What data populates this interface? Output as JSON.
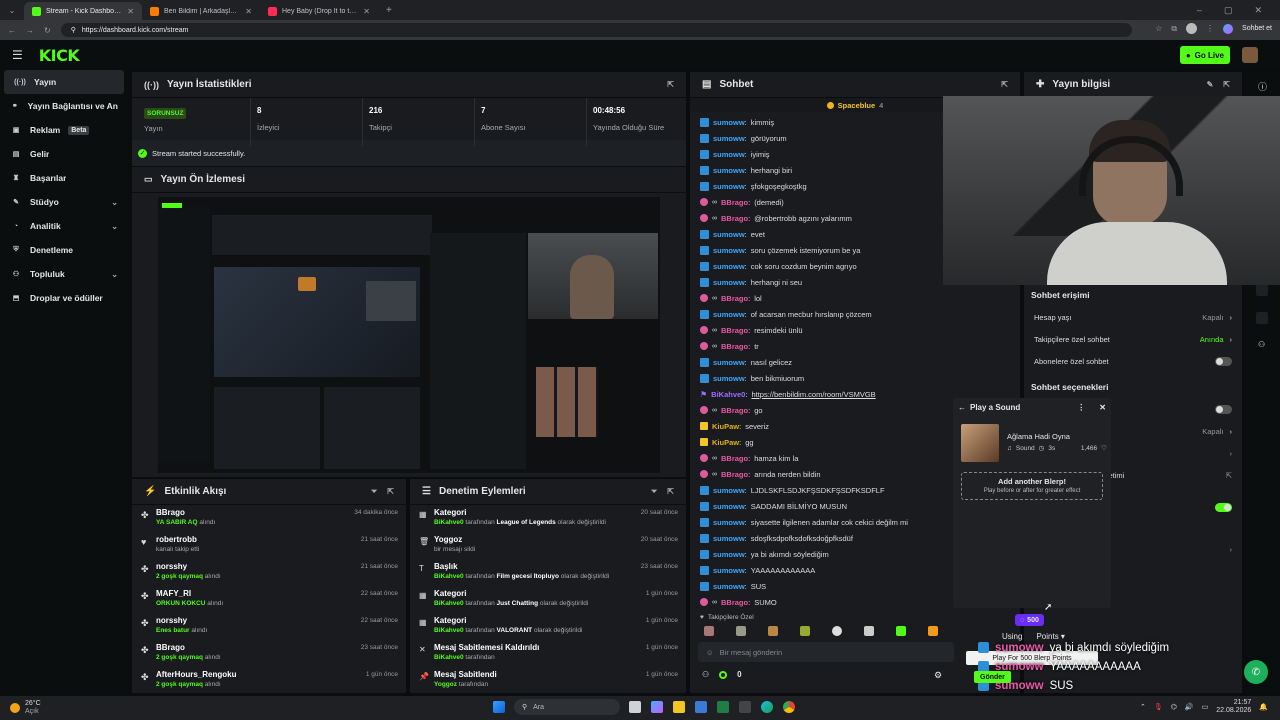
{
  "browser": {
    "tabs": [
      {
        "title": "Stream - Kick Dashboard",
        "color": "#53fc18"
      },
      {
        "title": "Ben Bildim | Arkadaşlarınla Online",
        "color": "#ff7a00"
      },
      {
        "title": "Hey Baby (Drop It to the Floo...",
        "color": "#ff2b55"
      }
    ],
    "url": "https://dashboard.kick.com/stream",
    "profile_label": "Sohbet et"
  },
  "app": {
    "logo": "KICK",
    "go_live": "Go Live"
  },
  "sidebar": [
    {
      "label": "Yayın",
      "icon": "broadcast-icon",
      "glyph": "((·))",
      "active": true,
      "chev": false,
      "beta": false
    },
    {
      "label": "Yayın Bağlantısı ve Anahtarı",
      "icon": "link-icon",
      "glyph": "⚭",
      "active": false,
      "chev": false,
      "beta": false
    },
    {
      "label": "Reklam",
      "icon": "ad-icon",
      "glyph": "▣",
      "active": false,
      "chev": false,
      "beta": true
    },
    {
      "label": "Gelir",
      "icon": "revenue-icon",
      "glyph": "▤",
      "active": false,
      "chev": false,
      "beta": false
    },
    {
      "label": "Başarılar",
      "icon": "trophy-icon",
      "glyph": "♜",
      "active": false,
      "chev": false,
      "beta": false
    },
    {
      "label": "Stüdyo",
      "icon": "studio-icon",
      "glyph": "✎",
      "active": false,
      "chev": true,
      "beta": false
    },
    {
      "label": "Analitik",
      "icon": "analytics-icon",
      "glyph": "◔",
      "active": false,
      "chev": true,
      "beta": false
    },
    {
      "label": "Denetleme",
      "icon": "moderation-icon",
      "glyph": "⛨",
      "active": false,
      "chev": false,
      "beta": false
    },
    {
      "label": "Topluluk",
      "icon": "community-icon",
      "glyph": "⚇",
      "active": false,
      "chev": true,
      "beta": false
    },
    {
      "label": "Droplar ve ödüller",
      "icon": "drops-icon",
      "glyph": "⬒",
      "active": false,
      "chev": false,
      "beta": false
    }
  ],
  "beta_label": "Beta",
  "stats": {
    "title": "Yayın İstatistikleri",
    "status_badge": "SORUNSUZ",
    "status_label": "Yayın",
    "viewers": "8",
    "viewers_label": "İzleyici",
    "followers": "216",
    "followers_label": "Takipçi",
    "subs": "7",
    "subs_label": "Abone Sayısı",
    "uptime": "00:48:56",
    "uptime_label": "Yayında Olduğu Süre",
    "message": "Stream started successfully."
  },
  "preview": {
    "title": "Yayın Ön İzlemesi"
  },
  "activity": {
    "title": "Etkinlik Akışı",
    "rows": [
      {
        "user": "BBrago",
        "detail_g": "YA SABIR AQ",
        "detail": " alındı",
        "time": "34 dakika önce",
        "icon": "reward-icon",
        "glyph": "✤"
      },
      {
        "user": "robertrobb",
        "detail_g": "",
        "detail": "kanalı takip etti",
        "time": "21 saat önce",
        "icon": "heart-icon",
        "glyph": "♥"
      },
      {
        "user": "norsshy",
        "detail_g": "2 goşk qaymaq",
        "detail": " alındı",
        "time": "21 saat önce",
        "icon": "reward-icon",
        "glyph": "✤"
      },
      {
        "user": "MAFY_RI",
        "detail_g": "ORKUN KOKCU",
        "detail": " alındı",
        "time": "22 saat önce",
        "icon": "reward-icon",
        "glyph": "✤"
      },
      {
        "user": "norsshy",
        "detail_g": "Enes batur",
        "detail": " alındı",
        "time": "22 saat önce",
        "icon": "reward-icon",
        "glyph": "✤"
      },
      {
        "user": "BBrago",
        "detail_g": "2 goşk qaymaq",
        "detail": " alındı",
        "time": "23 saat önce",
        "icon": "reward-icon",
        "glyph": "✤"
      },
      {
        "user": "AfterHours_Rengoku",
        "detail_g": "2 goşk qaymaq",
        "detail": " alındı",
        "time": "1 gün önce",
        "icon": "reward-icon",
        "glyph": "✤"
      }
    ]
  },
  "modlog": {
    "title": "Denetim Eylemleri",
    "rows": [
      {
        "title": "Kategori",
        "actor": "BiKahve0",
        "mid": " tarafından ",
        "bold": "League of Legends",
        "end": " olarak değiştirildi",
        "time": "20 saat önce",
        "icon": "category-icon",
        "glyph": "▦"
      },
      {
        "title": "Yoggoz",
        "actor": "",
        "mid": "bir mesajı sildi",
        "bold": "",
        "end": "",
        "time": "20 saat önce",
        "icon": "trash-icon",
        "glyph": "🗑"
      },
      {
        "title": "Başlık",
        "actor": "BiKahve0",
        "mid": " tarafından ",
        "bold": "Film gecesi İtopluyo",
        "end": " olarak değiştirildi",
        "time": "23 saat önce",
        "icon": "title-icon",
        "glyph": "T"
      },
      {
        "title": "Kategori",
        "actor": "BiKahve0",
        "mid": " tarafından ",
        "bold": "Just Chatting",
        "end": " olarak değiştirildi",
        "time": "1 gün önce",
        "icon": "category-icon",
        "glyph": "▦"
      },
      {
        "title": "Kategori",
        "actor": "BiKahve0",
        "mid": " tarafından ",
        "bold": "VALORANT",
        "end": " olarak değiştirildi",
        "time": "1 gün önce",
        "icon": "category-icon",
        "glyph": "▦"
      },
      {
        "title": "Mesaj Sabitlemesi Kaldırıldı",
        "actor": "BiKahve0",
        "mid": " tarafından",
        "bold": "",
        "end": "",
        "time": "1 gün önce",
        "icon": "unpin-icon",
        "glyph": "✕"
      },
      {
        "title": "Mesaj Sabitlendi",
        "actor": "Yoggoz",
        "mid": " tarafından",
        "bold": "",
        "end": "",
        "time": "1 gün önce",
        "icon": "pin-icon",
        "glyph": "📌"
      }
    ]
  },
  "chat": {
    "title": "Sohbet",
    "pinned": "Spaceblue",
    "pinned_count": "4",
    "messages": [
      {
        "user": "sumoww",
        "text": "kimmiş",
        "c": "s"
      },
      {
        "user": "sumoww",
        "text": "görüyorum",
        "c": "s"
      },
      {
        "user": "sumoww",
        "text": "iyimiş",
        "c": "s"
      },
      {
        "user": "sumoww",
        "text": "herhangi biri",
        "c": "s"
      },
      {
        "user": "sumoww",
        "text": "şfokgoşegkoştkg",
        "c": "s"
      },
      {
        "user": "BBrago",
        "text": "(demedi)",
        "c": "b"
      },
      {
        "user": "BBrago",
        "text": "@robertrobb agzını yalarımm",
        "c": "b"
      },
      {
        "user": "sumoww",
        "text": "evet",
        "c": "s"
      },
      {
        "user": "sumoww",
        "text": "soru çözemek istemiyorum be ya",
        "c": "s"
      },
      {
        "user": "sumoww",
        "text": "cok soru cozdum beynim agrıyo",
        "c": "s"
      },
      {
        "user": "sumoww",
        "text": "herhangi ni seu",
        "c": "s"
      },
      {
        "user": "BBrago",
        "text": "lol",
        "c": "b"
      },
      {
        "user": "sumoww",
        "text": "of acarsan mecbur hırslanıp çözcem",
        "c": "s"
      },
      {
        "user": "BBrago",
        "text": "resimdeki ünlü",
        "c": "b"
      },
      {
        "user": "BBrago",
        "text": "tr",
        "c": "b"
      },
      {
        "user": "sumoww",
        "text": "nasıl gelicez",
        "c": "s"
      },
      {
        "user": "sumoww",
        "text": "ben bikmiuorum",
        "c": "s"
      },
      {
        "user": "BiKahve0",
        "text": "https://benbildim.com/room/VSMVGB",
        "c": "k"
      },
      {
        "user": "BBrago",
        "text": "go",
        "c": "b"
      },
      {
        "user": "KiuPaw",
        "text": "severiz",
        "c": "y"
      },
      {
        "user": "KiuPaw",
        "text": "gg",
        "c": "y"
      },
      {
        "user": "BBrago",
        "text": "hamza kim la",
        "c": "b"
      },
      {
        "user": "BBrago",
        "text": "arında nerden bildin",
        "c": "b"
      },
      {
        "user": "sumoww",
        "text": "LJDLSKFLSDJKFŞSDKFŞSDFKSDFLF",
        "c": "s"
      },
      {
        "user": "sumoww",
        "text": "SADDAMI BİLMİYO MUSUN",
        "c": "s"
      },
      {
        "user": "sumoww",
        "text": "siyasette ilgilenen adamlar cok cekici değilm mi",
        "c": "s"
      },
      {
        "user": "sumoww",
        "text": "sdoşfksdpofksdofksdoğpfksdüf",
        "c": "s"
      },
      {
        "user": "sumoww",
        "text": "ya bi akımdı söylediğim",
        "c": "s"
      },
      {
        "user": "sumoww",
        "text": "YAAAAAAAAAAAA",
        "c": "s"
      },
      {
        "user": "sumoww",
        "text": "SUS",
        "c": "s"
      },
      {
        "user": "BBrago",
        "text": "SUMO",
        "c": "b"
      }
    ],
    "followers_only": "Takipçilere Özel",
    "input_placeholder": "Bir mesaj gönderin",
    "points": "0",
    "send": "Gönder"
  },
  "info": {
    "title": "Yayın bilgisi",
    "access_title": "Sohbet erişimi",
    "account_age": "Hesap yaşı",
    "account_age_val": "Kapalı",
    "followers_chat": "Takipçilere özel sohbet",
    "followers_chat_val": "Anında",
    "subs_chat": "Abonelere özel sohbet",
    "options_title": "Sohbet seçenekleri",
    "val_kapali": "Kapalı",
    "moderation_trunc": "denetimi"
  },
  "sound": {
    "title": "Play a Sound",
    "track": "Ağlama Hadi Oyna",
    "type": "Sound",
    "duration": "3s",
    "likes": "1,466",
    "add_title": "Add another Blerp!",
    "add_sub": "Play before or after for greater effect",
    "cost": "500",
    "using": "Using",
    "points": "Points",
    "play_btn": "Play For 500 Blerp Points"
  },
  "overlay": [
    {
      "user": "sumoww",
      "text": "ya bi akımdı söylediğim"
    },
    {
      "user": "sumoww",
      "text": "YAAAAAAAAAAA"
    },
    {
      "user": "sumoww",
      "text": "SUS"
    },
    {
      "user": "BBrago",
      "text": "SUMO"
    }
  ],
  "taskbar": {
    "weather": "26°C",
    "weather_sub": "Açık",
    "search": "Ara",
    "time": "21:57",
    "date": "22.08.2026"
  }
}
